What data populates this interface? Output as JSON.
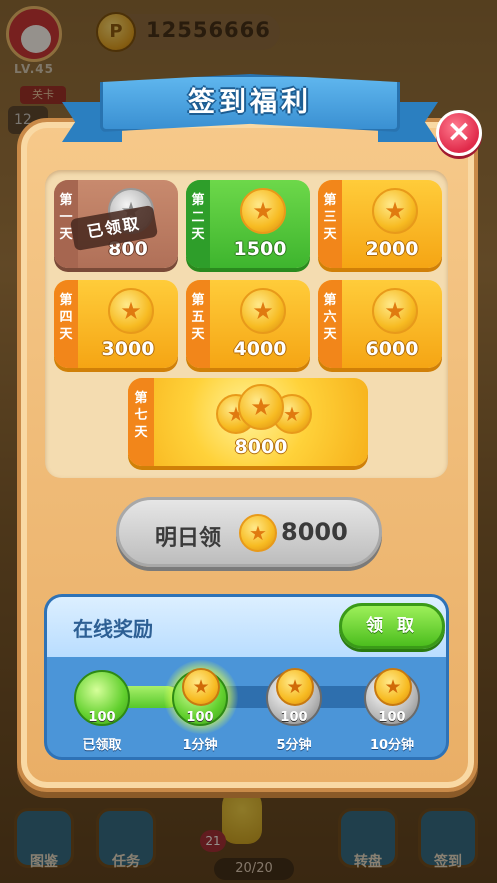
{
  "hud": {
    "level": "LV.45",
    "level_tag": "关卡",
    "level_number": "12",
    "coin_icon": "P",
    "coins": "12556666",
    "energy": "20/20",
    "badge": "21",
    "bottom_buttons": [
      "图鉴",
      "任务",
      "转盘",
      "签到"
    ]
  },
  "modal": {
    "title": "签到福利",
    "close": "×",
    "claimed_stamp": "已领取",
    "days": [
      {
        "label": "第一天",
        "amount": "800",
        "state": "claimed"
      },
      {
        "label": "第二天",
        "amount": "1500",
        "state": "available"
      },
      {
        "label": "第三天",
        "amount": "2000",
        "state": "locked"
      },
      {
        "label": "第四天",
        "amount": "3000",
        "state": "locked"
      },
      {
        "label": "第五天",
        "amount": "4000",
        "state": "locked"
      },
      {
        "label": "第六天",
        "amount": "6000",
        "state": "locked"
      }
    ],
    "day7": {
      "label": "第七天",
      "amount": "8000"
    },
    "tomorrow": {
      "label": "明日领",
      "amount": "8000"
    }
  },
  "online": {
    "title": "在线奖励",
    "claim_button": "领 取",
    "progress": 0.33,
    "nodes": [
      {
        "value": "100",
        "label": "已领取",
        "state": "claimed"
      },
      {
        "value": "100",
        "label": "1分钟",
        "state": "ready"
      },
      {
        "value": "100",
        "label": "5分钟",
        "state": "locked"
      },
      {
        "value": "100",
        "label": "10分钟",
        "state": "locked"
      }
    ]
  },
  "colors": {
    "ribbon": "#3a90d2",
    "gold_card": "#ffcc3a",
    "green_card": "#3eb52e",
    "claimed_card": "#b07058",
    "close": "#e02a4a"
  }
}
